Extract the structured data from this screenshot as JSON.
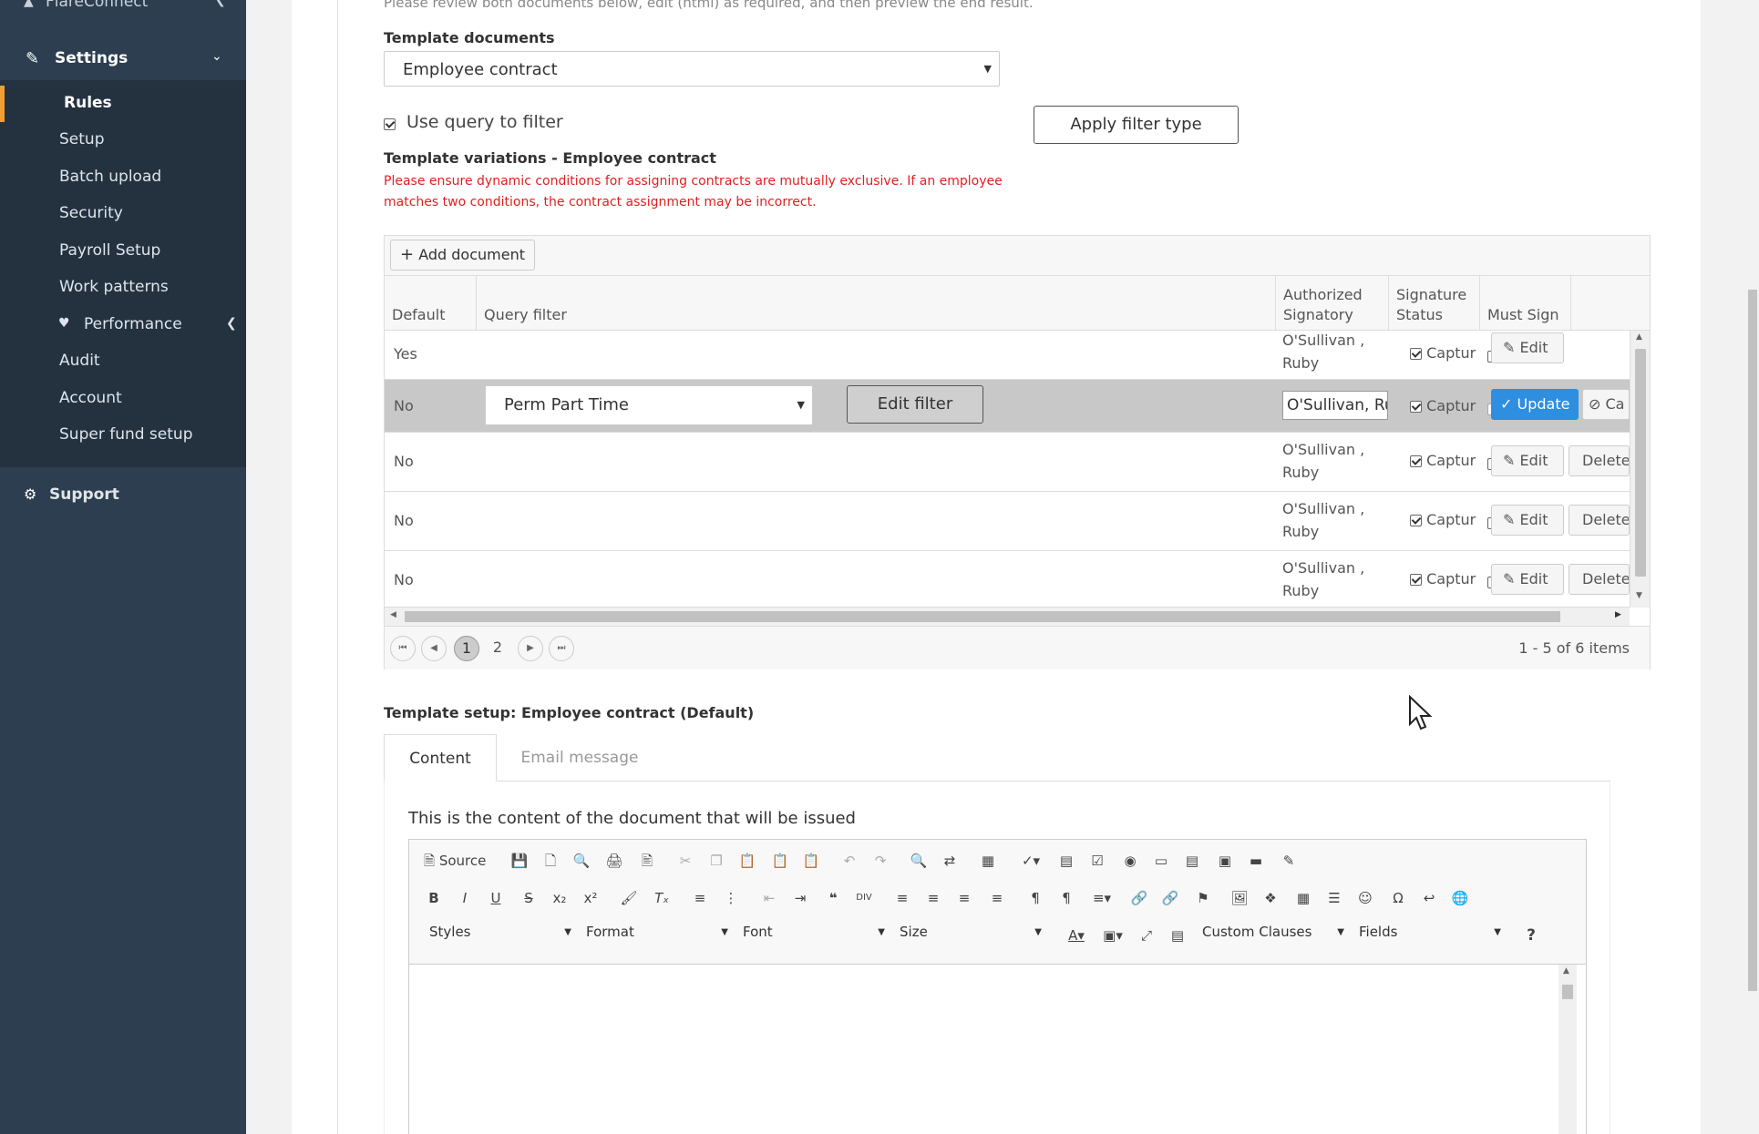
{
  "sidebar": {
    "top_label": "FlareConnect",
    "section": "Settings",
    "items": [
      {
        "label": "Rules",
        "active": true
      },
      {
        "label": "Setup"
      },
      {
        "label": "Batch upload"
      },
      {
        "label": "Security"
      },
      {
        "label": "Payroll Setup"
      },
      {
        "label": "Work patterns"
      },
      {
        "label": "Performance"
      },
      {
        "label": "Audit"
      },
      {
        "label": "Account"
      },
      {
        "label": "Super fund setup"
      }
    ],
    "support": "Support"
  },
  "intro_text": "Please review both documents below, edit (html) as required, and then preview the end result.",
  "template_documents": {
    "label": "Template documents",
    "value": "Employee contract"
  },
  "query_filter": {
    "label": "Use query to filter",
    "checked": true,
    "apply_button": "Apply filter type"
  },
  "variations": {
    "title": "Template variations - Employee contract",
    "warning": "Please ensure dynamic conditions for assigning contracts are mutually exclusive. If an employee matches two conditions, the contract assignment may be incorrect."
  },
  "grid": {
    "add_button": "Add document",
    "columns": [
      "Default",
      "Query filter",
      "Authorized Signatory",
      "Signature Status",
      "Must Sign"
    ],
    "rows": [
      {
        "default": "Yes",
        "signatory": "O'Sullivan , Ruby",
        "status": "Captur",
        "status_checked": true,
        "must_sign": false
      },
      {
        "default": "No",
        "filter_value": "Perm Part Time",
        "edit_filter": "Edit filter",
        "signatory_input": "O'Sullivan, Ru",
        "status": "Captur",
        "status_checked": true,
        "must_sign": false,
        "update": "Update",
        "cancel": "Ca"
      },
      {
        "default": "No",
        "signatory": "O'Sullivan , Ruby",
        "status": "Captur",
        "status_checked": true,
        "must_sign": false
      },
      {
        "default": "No",
        "signatory": "O'Sullivan , Ruby",
        "status": "Captur",
        "status_checked": true,
        "must_sign": false
      },
      {
        "default": "No",
        "signatory": "O'Sullivan , Ruby",
        "status": "Captur",
        "status_checked": true,
        "must_sign": false
      }
    ],
    "edit_label": "Edit",
    "delete_label": "Delete",
    "pager": {
      "current": "1",
      "next": "2",
      "summary": "1 - 5 of 6 items"
    }
  },
  "template_setup": {
    "title": "Template setup: Employee contract (Default)",
    "tabs": [
      "Content",
      "Email message"
    ],
    "content_desc": "This is the content of the document that will be issued"
  },
  "editor": {
    "source": "Source",
    "combos": [
      "Styles",
      "Format",
      "Font",
      "Size",
      "Custom Clauses",
      "Fields"
    ]
  }
}
